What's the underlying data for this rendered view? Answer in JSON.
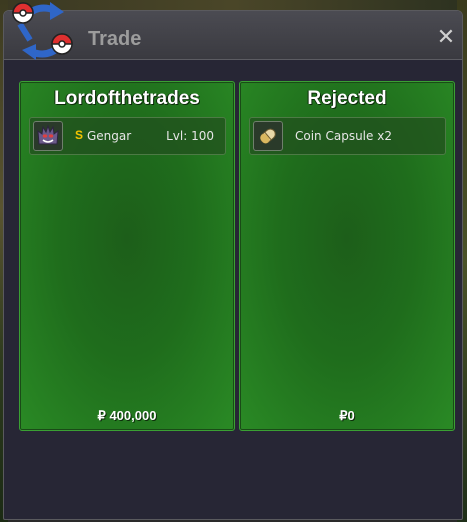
{
  "window": {
    "title": "Trade",
    "close_glyph": "✕",
    "logo_icon": "trade-swap-pokeball-icon"
  },
  "left_panel": {
    "player_name": "Lordofthetrades",
    "item": {
      "icon": "gengar-icon",
      "shiny_badge": "S",
      "name": "Gengar",
      "level": "Lvl: 100"
    },
    "money_symbol": "₽",
    "money": "400,000"
  },
  "right_panel": {
    "status": "Rejected",
    "item": {
      "icon": "coin-capsule-icon",
      "name": "Coin Capsule",
      "quantity": "x2"
    },
    "money_symbol": "₽",
    "money": "0"
  },
  "colors": {
    "panel_green": "#1f6d1c",
    "panel_border": "#3aa033",
    "window_bg": "#272635",
    "titlebar": "#424248",
    "title_text": "#9c9c9c",
    "shiny_gold": "#f3c300"
  }
}
